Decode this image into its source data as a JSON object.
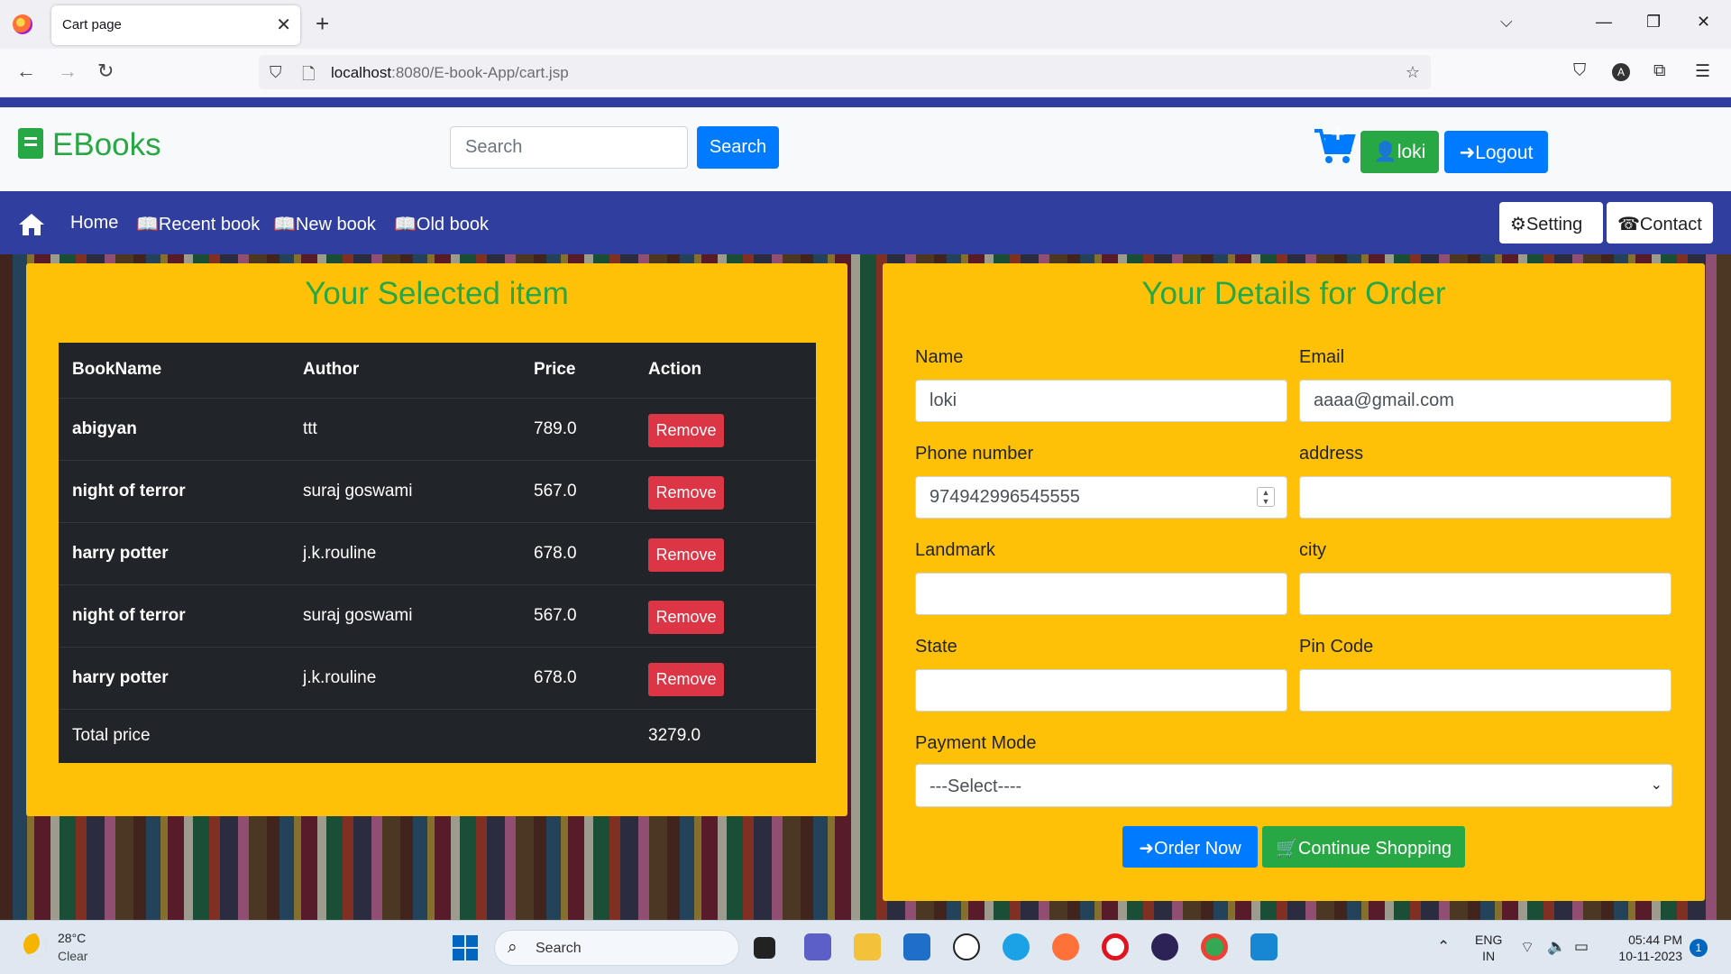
{
  "browser": {
    "tab_title": "Cart page",
    "url_host": "localhost",
    "url_path": ":8080/E-book-App/cart.jsp",
    "profile_initial": "A"
  },
  "header": {
    "brand": "EBooks",
    "search_placeholder": "Search",
    "search_button": "Search",
    "user_label": "loki",
    "logout_label": "Logout"
  },
  "nav": {
    "home": "Home",
    "recent": "Recent book",
    "new": "New book",
    "old": "Old book",
    "setting": "Setting",
    "contact": "Contact"
  },
  "cart": {
    "title": "Your Selected item",
    "columns": [
      "BookName",
      "Author",
      "Price",
      "Action"
    ],
    "rows": [
      {
        "book": "abigyan",
        "author": "ttt",
        "price": "789.0",
        "action": "Remove"
      },
      {
        "book": "night of terror",
        "author": "suraj goswami",
        "price": "567.0",
        "action": "Remove"
      },
      {
        "book": "harry potter",
        "author": "j.k.rouline",
        "price": "678.0",
        "action": "Remove"
      },
      {
        "book": "night of terror",
        "author": "suraj goswami",
        "price": "567.0",
        "action": "Remove"
      },
      {
        "book": "harry potter",
        "author": "j.k.rouline",
        "price": "678.0",
        "action": "Remove"
      }
    ],
    "total_label": "Total price",
    "total_value": "3279.0"
  },
  "order": {
    "title": "Your Details for Order",
    "name_label": "Name",
    "name_value": "loki",
    "email_label": "Email",
    "email_value": "aaaa@gmail.com",
    "phone_label": "Phone number",
    "phone_value": "974942996545555",
    "address_label": "address",
    "address_value": "",
    "landmark_label": "Landmark",
    "landmark_value": "",
    "city_label": "city",
    "city_value": "",
    "state_label": "State",
    "state_value": "",
    "pin_label": "Pin Code",
    "pin_value": "",
    "payment_label": "Payment Mode",
    "payment_selected": "---Select----",
    "order_button": "Order Now",
    "continue_button": "Continue Shopping"
  },
  "taskbar": {
    "temperature": "28°C",
    "condition": "Clear",
    "search_label": "Search",
    "lang": "ENG",
    "region": "IN",
    "time": "05:44 PM",
    "date": "10-11-2023",
    "notifications": "1"
  },
  "colors": {
    "nav_blue": "#303f9f",
    "card_yellow": "#ffc107",
    "brand_green": "#28a745",
    "primary_blue": "#007bff",
    "danger_red": "#dc3545",
    "table_dark": "#212529"
  }
}
